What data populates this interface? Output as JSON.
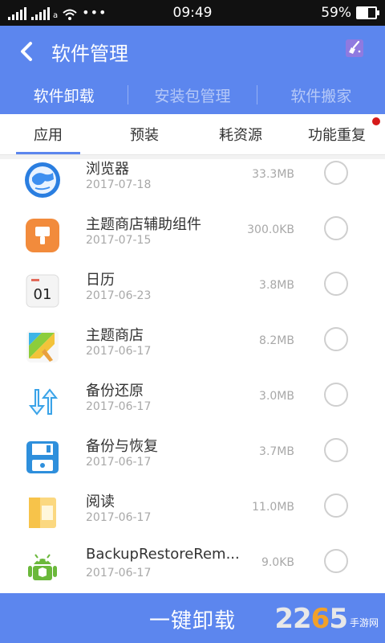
{
  "status": {
    "time": "09:49",
    "battery": "59%",
    "battery_level": 0.59
  },
  "header": {
    "title": "软件管理"
  },
  "top_tabs": [
    "软件卸载",
    "安装包管理",
    "软件搬家"
  ],
  "sub_tabs": [
    "应用",
    "预装",
    "耗资源",
    "功能重复"
  ],
  "apps": [
    {
      "name": "浏览器",
      "date": "2017-07-18",
      "size": "33.3MB",
      "icon": "browser-icon"
    },
    {
      "name": "主题商店辅助组件",
      "date": "2017-07-15",
      "size": "300.0KB",
      "icon": "theme-helper-icon"
    },
    {
      "name": "日历",
      "date": "2017-06-23",
      "size": "3.8MB",
      "icon": "calendar-icon"
    },
    {
      "name": "主题商店",
      "date": "2017-06-17",
      "size": "8.2MB",
      "icon": "theme-store-icon"
    },
    {
      "name": "备份还原",
      "date": "2017-06-17",
      "size": "3.0MB",
      "icon": "backup-restore-icon"
    },
    {
      "name": "备份与恢复",
      "date": "2017-06-17",
      "size": "3.7MB",
      "icon": "floppy-icon"
    },
    {
      "name": "阅读",
      "date": "2017-06-17",
      "size": "11.0MB",
      "icon": "reader-icon"
    },
    {
      "name": "BackupRestoreRem...",
      "date": "2017-06-17",
      "size": "9.0KB",
      "icon": "android-icon"
    }
  ],
  "calendar_icon_text": "01",
  "bottom": {
    "action": "一键卸载"
  },
  "watermark": {
    "number_prefix": "22",
    "number_accent": "6",
    "number_suffix": "5",
    "text": "手游网"
  },
  "colors": {
    "accent": "#5c86ee",
    "badge": "#d61a1a"
  }
}
